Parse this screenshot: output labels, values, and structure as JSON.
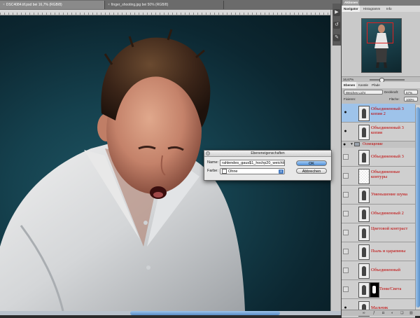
{
  "document_tabs": [
    {
      "label": "DSC4084.tif.psd bei 16,7% (RGB/8)"
    },
    {
      "label": "finger_shooting.jpg bei 50% (RGB/8)"
    }
  ],
  "side_strip": {
    "icons": [
      "actions-icon",
      "history-icon",
      "tool-presets-icon"
    ]
  },
  "top_panel_tabs": [
    {
      "label": "Aktionen"
    }
  ],
  "navigator_panel": {
    "tabs": [
      {
        "label": "Navigator"
      },
      {
        "label": "Histogramm"
      },
      {
        "label": "Info"
      }
    ],
    "zoom": "16,67%"
  },
  "layers_panel": {
    "tabs": [
      {
        "label": "Ebenen"
      },
      {
        "label": "Kanäle"
      },
      {
        "label": "Pfade"
      }
    ],
    "blend_mode": "Weiches Licht",
    "opacity_label": "Deckkraft:",
    "opacity_value": "57%",
    "lock_label": "Fixieren:",
    "fill_label": "Fläche:",
    "fill_value": "100%",
    "layers": [
      {
        "name": "Объединенный 3 копия 2",
        "selected": true,
        "visible": true,
        "type": "layer"
      },
      {
        "name": "Объединенный 3 копия",
        "selected": false,
        "visible": true,
        "type": "layer"
      },
      {
        "name": "Освещение",
        "selected": false,
        "visible": true,
        "type": "group"
      },
      {
        "name": "Объединенный 3",
        "selected": false,
        "visible": false,
        "type": "layer"
      },
      {
        "name": "Объединенные контуры",
        "selected": false,
        "visible": false,
        "type": "layer"
      },
      {
        "name": "Уменьшение шума",
        "selected": false,
        "visible": false,
        "type": "layer"
      },
      {
        "name": "Объединенный 2",
        "selected": false,
        "visible": false,
        "type": "layer"
      },
      {
        "name": "Цветовой контраст",
        "selected": false,
        "visible": false,
        "type": "layer"
      },
      {
        "name": "Пыль и царапины",
        "selected": false,
        "visible": false,
        "type": "layer"
      },
      {
        "name": "Объединенный",
        "selected": false,
        "visible": false,
        "type": "layer"
      },
      {
        "name": "Тени/Света",
        "selected": false,
        "visible": false,
        "type": "layer"
      },
      {
        "name": "Мальчик",
        "selected": false,
        "visible": true,
        "type": "layer"
      }
    ]
  },
  "dialog": {
    "title": "Ebeneneigenschaften",
    "name_label": "Name:",
    "name_value": "rahlendes_gaus$1_hochp20_weichlicht",
    "color_label": "Farbe:",
    "color_value": "Ohne",
    "ok_label": "OK",
    "cancel_label": "Abbrechen"
  },
  "colors": {
    "selection_blue": "#9ec3ea",
    "layer_name_red": "#c00000",
    "canvas_bg": "#15414e"
  }
}
